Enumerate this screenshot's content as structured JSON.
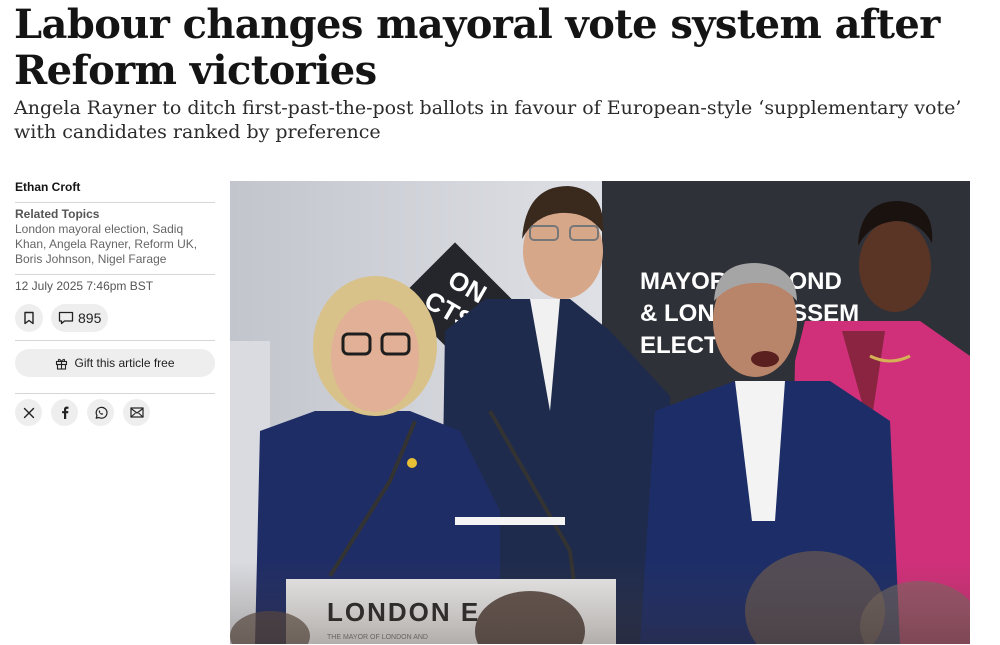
{
  "article": {
    "headline": "Labour changes mayoral vote system after Reform victories",
    "standfirst": "Angela Rayner to ditch first-past-the-post ballots in favour of European-style ‘supplementary vote’ with candidates ranked by preference"
  },
  "sidebar": {
    "author": "Ethan Croft",
    "topics_title": "Related Topics",
    "topics_list": "London mayoral election, Sadiq Khan, Angela Rayner, Reform UK, Boris Johnson, Nigel Farage",
    "date": "12 July 2025 7:46pm BST",
    "comment_count": "895",
    "gift_label": "Gift this article free",
    "icons": [
      "bookmark-icon",
      "comment-icon",
      "gift-icon",
      "x-icon",
      "facebook-icon",
      "whatsapp-icon",
      "email-icon"
    ]
  },
  "photo": {
    "backdrop_text_line1": "MAYOR OF LOND",
    "backdrop_text_line2": "& LONDON ASSEM",
    "backdrop_text_line3": "ELECT",
    "logo_text_line1": "ON",
    "logo_text_line2": "CTS",
    "lectern_text": "LONDON E",
    "lectern_subtext": "THE MAYOR OF LONDON AND"
  }
}
